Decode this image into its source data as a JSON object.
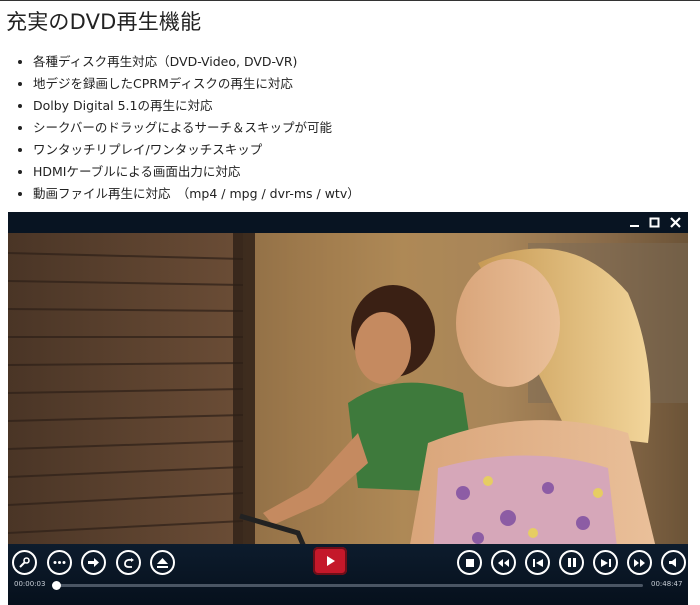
{
  "page": {
    "title": "充実のDVD再生機能",
    "features": [
      "各種ディスク再生対応（DVD-Video, DVD-VR)",
      "地デジを録画したCPRMディスクの再生に対応",
      "Dolby Digital 5.1の再生に対応",
      "シークバーのドラッグによるサーチ＆スキップが可能",
      "ワンタッチリプレイ/ワンタッチスキップ",
      "HDMIケーブルによる画面出力に対応",
      "動画ファイル再生に対応　（mp4 / mpg / dvr-ms / wtv）"
    ]
  },
  "player": {
    "window_buttons": [
      "minimize-icon",
      "maximize-icon",
      "close-icon"
    ],
    "left_controls": [
      "settings-icon",
      "more-icon",
      "next-chapter-icon",
      "return-icon",
      "eject-icon"
    ],
    "center_control": "record-icon",
    "right_controls": [
      "stop-icon",
      "rewind-icon",
      "previous-icon",
      "pause-icon",
      "next-icon",
      "fast-forward-icon",
      "volume-icon"
    ],
    "elapsed_time": "00:00:03",
    "total_time": "00:48:47",
    "progress_fraction": 0.003,
    "colors": {
      "accent": "#c4182a",
      "frame": "#05101d",
      "control_icon": "#ffffff"
    }
  }
}
